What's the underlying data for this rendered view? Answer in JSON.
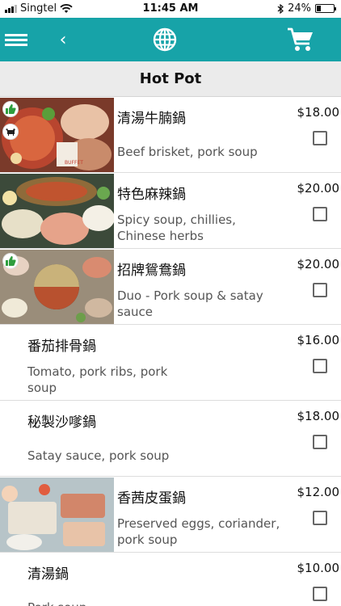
{
  "status_bar": {
    "carrier": "Singtel",
    "time": "11:45 AM",
    "battery": "24%",
    "battery_level": 0.24
  },
  "nav": {
    "icons": [
      "menu-icon",
      "back-icon",
      "globe-icon",
      "cart-icon"
    ],
    "back_glyph": "‹"
  },
  "page": {
    "title": "Hot Pot"
  },
  "colors": {
    "accent": "#17a3a8",
    "header_bg": "#ebebeb",
    "badge_green": "#2e9e3e"
  },
  "menu": [
    {
      "name": "清湯牛腩鍋",
      "desc": "Beef brisket, pork soup",
      "price": "$18.00",
      "has_image": true,
      "badges": [
        "thumbs-up-icon",
        "cow-icon"
      ],
      "checked": false
    },
    {
      "name": "特色麻辣鍋",
      "desc": "Spicy soup, chillies, Chinese herbs",
      "price": "$20.00",
      "has_image": true,
      "badges": [],
      "checked": false
    },
    {
      "name": "招牌鴛鴦鍋",
      "desc": "Duo - Pork soup & satay sauce",
      "price": "$20.00",
      "has_image": true,
      "badges": [
        "thumbs-up-icon"
      ],
      "checked": false
    },
    {
      "name": "番茄排骨鍋",
      "desc": "Tomato, pork ribs, pork soup",
      "price": "$16.00",
      "has_image": false,
      "badges": [],
      "checked": false
    },
    {
      "name": "秘製沙嗲鍋",
      "desc": "Satay sauce, pork soup",
      "price": "$18.00",
      "has_image": false,
      "badges": [],
      "checked": false
    },
    {
      "name": "香茜皮蛋鍋",
      "desc": "Preserved eggs, coriander, pork soup",
      "price": "$12.00",
      "has_image": true,
      "badges": [],
      "checked": false
    },
    {
      "name": "清湯鍋",
      "desc": "Pork soup",
      "price": "$10.00",
      "has_image": false,
      "badges": [],
      "checked": false
    }
  ]
}
